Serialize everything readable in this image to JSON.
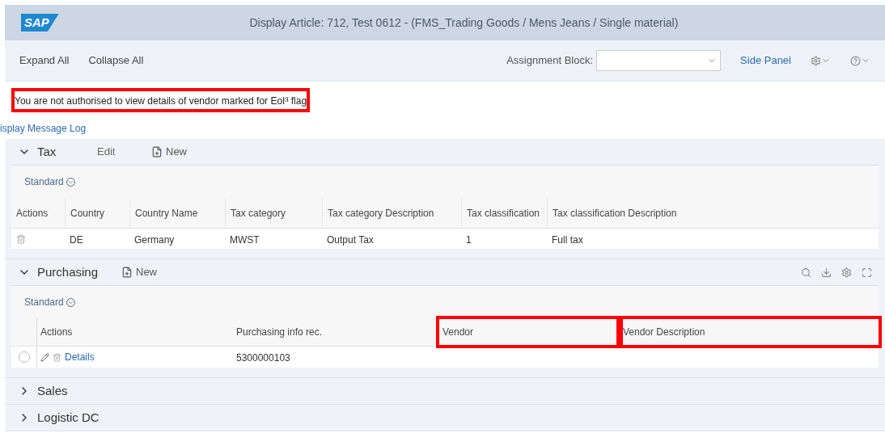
{
  "header": {
    "logo": "SAP",
    "title": "Display Article: 712, Test 0612 - (FMS_Trading Goods / Mens Jeans / Single material)"
  },
  "toolbar": {
    "buttons": [
      "Expand All",
      "Collapse All"
    ],
    "assignment_label": "Assignment Block:",
    "side_panel": "Side Panel"
  },
  "message": {
    "text": "You are not authorised to view details of vendor marked for EoI³ flag",
    "highlighted": true
  },
  "message_log": "isplay Message Log",
  "sections": [
    {
      "title": "Tax",
      "expanded": true,
      "actions": [
        {
          "kind": "text",
          "label": "Edit"
        },
        {
          "kind": "new",
          "label": "New"
        }
      ],
      "table_tools": false,
      "view": "Standard",
      "kind": "tax",
      "columns": [
        {
          "label": "Actions",
          "highlighted": false
        },
        {
          "label": "Country",
          "highlighted": false
        },
        {
          "label": "Country Name",
          "highlighted": false
        },
        {
          "label": "Tax category",
          "highlighted": false
        },
        {
          "label": "Tax category Description",
          "highlighted": false
        },
        {
          "label": "Tax classification",
          "highlighted": false
        },
        {
          "label": "Tax classification Description",
          "highlighted": false
        }
      ],
      "rows": [
        {
          "cells": [
            "",
            "DE",
            "Germany",
            "MWST",
            "Output Tax",
            "1",
            "Full tax"
          ]
        }
      ]
    },
    {
      "title": "Purchasing",
      "expanded": true,
      "actions": [
        {
          "kind": "new",
          "label": "New"
        }
      ],
      "table_tools": true,
      "view": "Standard",
      "kind": "purchasing",
      "columns": [
        {
          "label": "Actions",
          "highlighted": false
        },
        {
          "label": "Purchasing info rec.",
          "highlighted": false
        },
        {
          "label": "Vendor",
          "highlighted": true
        },
        {
          "label": "Vendor Description",
          "highlighted": true
        }
      ],
      "rows": [
        {
          "selected": false,
          "cells": [
            "Details",
            "5300000103",
            "",
            ""
          ]
        }
      ]
    },
    {
      "title": "Sales",
      "expanded": false
    },
    {
      "title": "Logistic DC",
      "expanded": false
    }
  ]
}
